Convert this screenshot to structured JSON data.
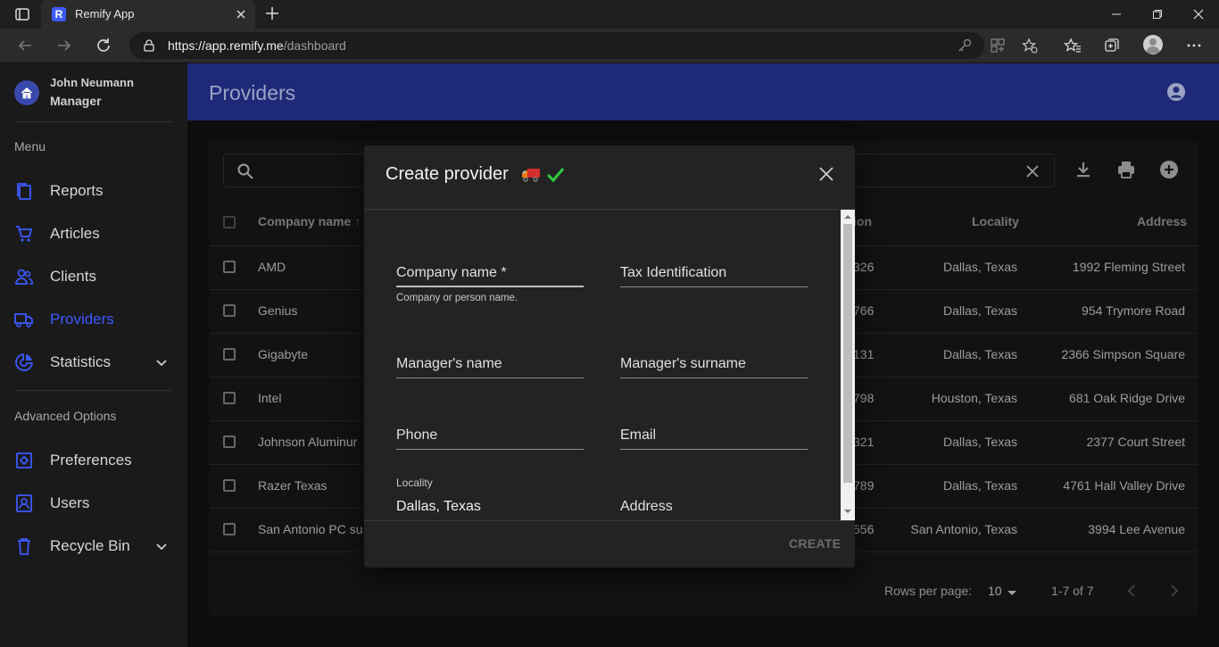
{
  "browser": {
    "tab_title": "Remify App",
    "tab_favicon_letter": "R",
    "url_main": "https://app.remify.me",
    "url_path": "/dashboard"
  },
  "sidebar": {
    "user_name": "John Neumann",
    "user_role": "Manager",
    "menu_heading": "Menu",
    "items": [
      {
        "label": "Reports",
        "icon": "reports-icon"
      },
      {
        "label": "Articles",
        "icon": "cart-icon"
      },
      {
        "label": "Clients",
        "icon": "people-icon"
      },
      {
        "label": "Providers",
        "icon": "truck-icon",
        "active": true
      },
      {
        "label": "Statistics",
        "icon": "chart-icon",
        "expandable": true
      }
    ],
    "advanced_heading": "Advanced Options",
    "advanced_items": [
      {
        "label": "Preferences",
        "icon": "preferences-icon"
      },
      {
        "label": "Users",
        "icon": "user-card-icon"
      },
      {
        "label": "Recycle Bin",
        "icon": "trash-icon",
        "expandable": true
      }
    ]
  },
  "header": {
    "title": "Providers"
  },
  "table": {
    "columns": {
      "company": "Company name",
      "tax_partial": "ion",
      "locality": "Locality",
      "address": "Address"
    },
    "rows": [
      {
        "company": "AMD",
        "tax_partial": "326",
        "locality": "Dallas, Texas",
        "address": "1992 Fleming Street"
      },
      {
        "company": "Genius",
        "tax_partial": "766",
        "locality": "Dallas, Texas",
        "address": "954 Trymore Road"
      },
      {
        "company": "Gigabyte",
        "tax_partial": "131",
        "locality": "Dallas, Texas",
        "address": "2366 Simpson Square"
      },
      {
        "company": "Intel",
        "tax_partial": "798",
        "locality": "Houston, Texas",
        "address": "681 Oak Ridge Drive"
      },
      {
        "company": "Johnson Aluminur",
        "tax_partial": "321",
        "locality": "Dallas, Texas",
        "address": "2377 Court Street"
      },
      {
        "company": "Razer Texas",
        "tax_partial": "789",
        "locality": "Dallas, Texas",
        "address": "4761 Hall Valley Drive"
      },
      {
        "company": "San Antonio PC su",
        "tax_partial": "556",
        "locality": "San Antonio, Texas",
        "address": "3994 Lee Avenue"
      }
    ],
    "rows_per_page_label": "Rows per page:",
    "rows_per_page_value": "10",
    "range": "1-7 of 7"
  },
  "modal": {
    "title": "Create provider",
    "fields": {
      "company_name_label": "Company name *",
      "company_name_help": "Company or person name.",
      "tax_id_label": "Tax Identification",
      "manager_name_label": "Manager's name",
      "manager_surname_label": "Manager's surname",
      "phone_label": "Phone",
      "email_label": "Email",
      "locality_label": "Locality",
      "locality_value": "Dallas, Texas",
      "address_label": "Address"
    },
    "create_label": "CREATE"
  },
  "colors": {
    "accent": "#3d5afe",
    "appbar": "#1e2a78",
    "success_check": "#2ecc40"
  }
}
